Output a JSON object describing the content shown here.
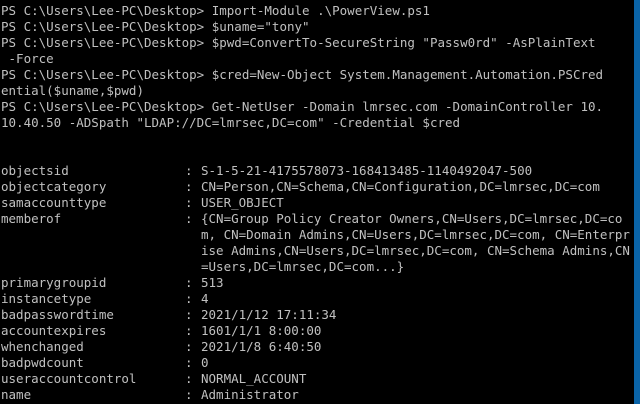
{
  "commands": [
    {
      "prompt": "PS C:\\Users\\Lee-PC\\Desktop> ",
      "command": "Import-Module .\\PowerView.ps1",
      "continuation": ""
    },
    {
      "prompt": "PS C:\\Users\\Lee-PC\\Desktop> ",
      "command": "$uname=\"tony\"",
      "continuation": ""
    },
    {
      "prompt": "PS C:\\Users\\Lee-PC\\Desktop> ",
      "command": "$pwd=ConvertTo-SecureString \"Passw0rd\" -AsPlainText",
      "continuation": " -Force"
    },
    {
      "prompt": "PS C:\\Users\\Lee-PC\\Desktop> ",
      "command": "$cred=New-Object System.Management.Automation.PSCred",
      "continuation": "ential($uname,$pwd)"
    },
    {
      "prompt": "PS C:\\Users\\Lee-PC\\Desktop> ",
      "command": "Get-NetUser -Domain lmrsec.com -DomainController 10.",
      "continuation": "10.40.50 -ADSpath \"LDAP://DC=lmrsec,DC=com\" -Credential $cred"
    }
  ],
  "properties": [
    {
      "name": "objectsid",
      "value": "S-1-5-21-4175578073-168413485-1140492047-500"
    },
    {
      "name": "objectcategory",
      "value": "CN=Person,CN=Schema,CN=Configuration,DC=lmrsec,DC=com"
    },
    {
      "name": "samaccounttype",
      "value": "USER_OBJECT"
    },
    {
      "name": "memberof",
      "value": "{CN=Group Policy Creator Owners,CN=Users,DC=lmrsec,DC=com, CN=Domain Admins,CN=Users,DC=lmrsec,DC=com, CN=Enterprise Admins,CN=Users,DC=lmrsec,DC=com, CN=Schema Admins,CN=Users,DC=lmrsec,DC=com...}"
    },
    {
      "name": "primarygroupid",
      "value": "513"
    },
    {
      "name": "instancetype",
      "value": "4"
    },
    {
      "name": "badpasswordtime",
      "value": "2021/1/12 17:11:34"
    },
    {
      "name": "accountexpires",
      "value": "1601/1/1 8:00:00"
    },
    {
      "name": "whenchanged",
      "value": "2021/1/8 6:40:50"
    },
    {
      "name": "badpwdcount",
      "value": "0"
    },
    {
      "name": "useraccountcontrol",
      "value": "NORMAL_ACCOUNT"
    },
    {
      "name": "name",
      "value": "Administrator"
    }
  ],
  "separator": ": ",
  "colors": {
    "background": "#000000",
    "foreground": "#c0c0c0",
    "scrollbar": "#0a64a8"
  }
}
